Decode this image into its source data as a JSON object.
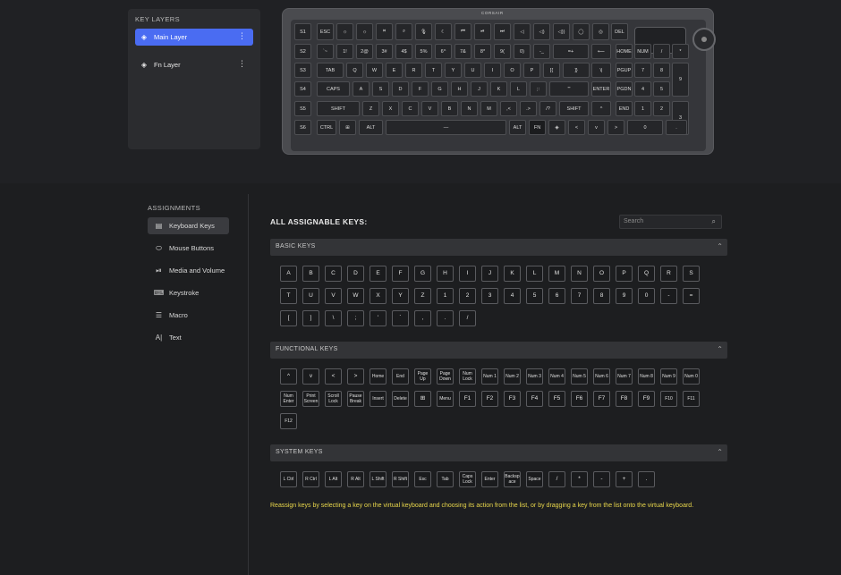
{
  "key_layers": {
    "title": "KEY LAYERS",
    "items": [
      {
        "label": "Main Layer",
        "active": true
      },
      {
        "label": "Fn Layer",
        "active": false
      }
    ]
  },
  "keyboard": {
    "brand": "CORSAIR",
    "rows": [
      [
        "S1",
        "ESC",
        "☼",
        "☼",
        "⌗",
        "⌕",
        "🎙",
        "☾",
        "⏮",
        "⏯",
        "⏭",
        "◁",
        "◁)",
        "◁))",
        "◯",
        "◎",
        "DEL"
      ],
      [
        "S2",
        "`~",
        "1!",
        "2@",
        "3#",
        "4$",
        "5%",
        "6^",
        "7&",
        "8*",
        "9(",
        "0)",
        "-_",
        "=+",
        "⟵",
        "HOME",
        "NUM",
        "/",
        "*",
        "-"
      ],
      [
        "S3",
        "TAB",
        "Q",
        "W",
        "E",
        "R",
        "T",
        "Y",
        "U",
        "I",
        "O",
        "P",
        "[{",
        "]}",
        "\\|",
        "PGUP",
        "7",
        "8",
        "9",
        "+"
      ],
      [
        "S4",
        "CAPS",
        "A",
        "S",
        "D",
        "F",
        "G",
        "H",
        "J",
        "K",
        "L",
        ";:",
        "'\"",
        "ENTER",
        "PGDN",
        "4",
        "5",
        "6"
      ],
      [
        "S5",
        "SHIFT",
        "Z",
        "X",
        "C",
        "V",
        "B",
        "N",
        "M",
        ",<",
        ".>",
        "/?",
        "SHIFT",
        "^",
        "END",
        "1",
        "2",
        "3",
        "ENT"
      ],
      [
        "S6",
        "CTRL",
        "⊞",
        "ALT",
        "—",
        "ALT",
        "FN",
        "◈",
        "<",
        "v",
        ">",
        "0",
        "."
      ]
    ]
  },
  "sidebar": {
    "title": "ASSIGNMENTS",
    "items": [
      {
        "label": "Keyboard Keys",
        "icon": "keyboard-icon",
        "glyph": "▤",
        "active": true
      },
      {
        "label": "Mouse Buttons",
        "icon": "mouse-icon",
        "glyph": "⬭",
        "active": false
      },
      {
        "label": "Media and Volume",
        "icon": "media-icon",
        "glyph": "⏯",
        "active": false
      },
      {
        "label": "Keystroke",
        "icon": "keystroke-icon",
        "glyph": "⌨",
        "active": false
      },
      {
        "label": "Macro",
        "icon": "macro-icon",
        "glyph": "☰",
        "active": false
      },
      {
        "label": "Text",
        "icon": "text-icon",
        "glyph": "A|",
        "active": false
      }
    ]
  },
  "main": {
    "title": "ALL ASSIGNABLE KEYS:",
    "search_placeholder": "Search",
    "sections": [
      {
        "title": "BASIC KEYS",
        "rows": [
          [
            "A",
            "B",
            "C",
            "D",
            "E",
            "F",
            "G",
            "H",
            "I",
            "J",
            "K",
            "L",
            "M",
            "N",
            "O",
            "P",
            "Q",
            "R",
            "S"
          ],
          [
            "T",
            "U",
            "V",
            "W",
            "X",
            "Y",
            "Z",
            "1",
            "2",
            "3",
            "4",
            "5",
            "6",
            "7",
            "8",
            "9",
            "0",
            "-",
            "="
          ],
          [
            "[",
            "]",
            "\\",
            ";",
            "'",
            "`",
            ",",
            ".",
            "/"
          ]
        ]
      },
      {
        "title": "FUNCTIONAL KEYS",
        "rows": [
          [
            "^",
            "v",
            "<",
            ">",
            "Home",
            "End",
            "Page Up",
            "Page Down",
            "Num Lock",
            "Num 1",
            "Num 2",
            "Num 3",
            "Num 4",
            "Num 5",
            "Num 6",
            "Num 7",
            "Num 8",
            "Num 9",
            "Num 0"
          ],
          [
            "Num Enter",
            "Print Screen",
            "Scroll Lock",
            "Pause Break",
            "Insert",
            "Delete",
            "⊞",
            "Menu",
            "F1",
            "F2",
            "F3",
            "F4",
            "F5",
            "F6",
            "F7",
            "F8",
            "F9",
            "F10",
            "F11"
          ],
          [
            "F12"
          ]
        ]
      },
      {
        "title": "SYSTEM KEYS",
        "rows": [
          [
            "L Ctrl",
            "R Ctrl",
            "L Alt",
            "R Alt",
            "L Shift",
            "R Shift",
            "Esc",
            "Tab",
            "Caps Lock",
            "Enter",
            "Backsp ace",
            "Space",
            "/",
            "*",
            "-",
            "+",
            "."
          ]
        ]
      }
    ],
    "hint": "Reassign keys by selecting a key on the virtual keyboard and choosing its action from the list, or by dragging a key from the list onto the virtual keyboard."
  },
  "colors": {
    "accent": "#4a6cf2",
    "hint": "#e8d64b"
  }
}
